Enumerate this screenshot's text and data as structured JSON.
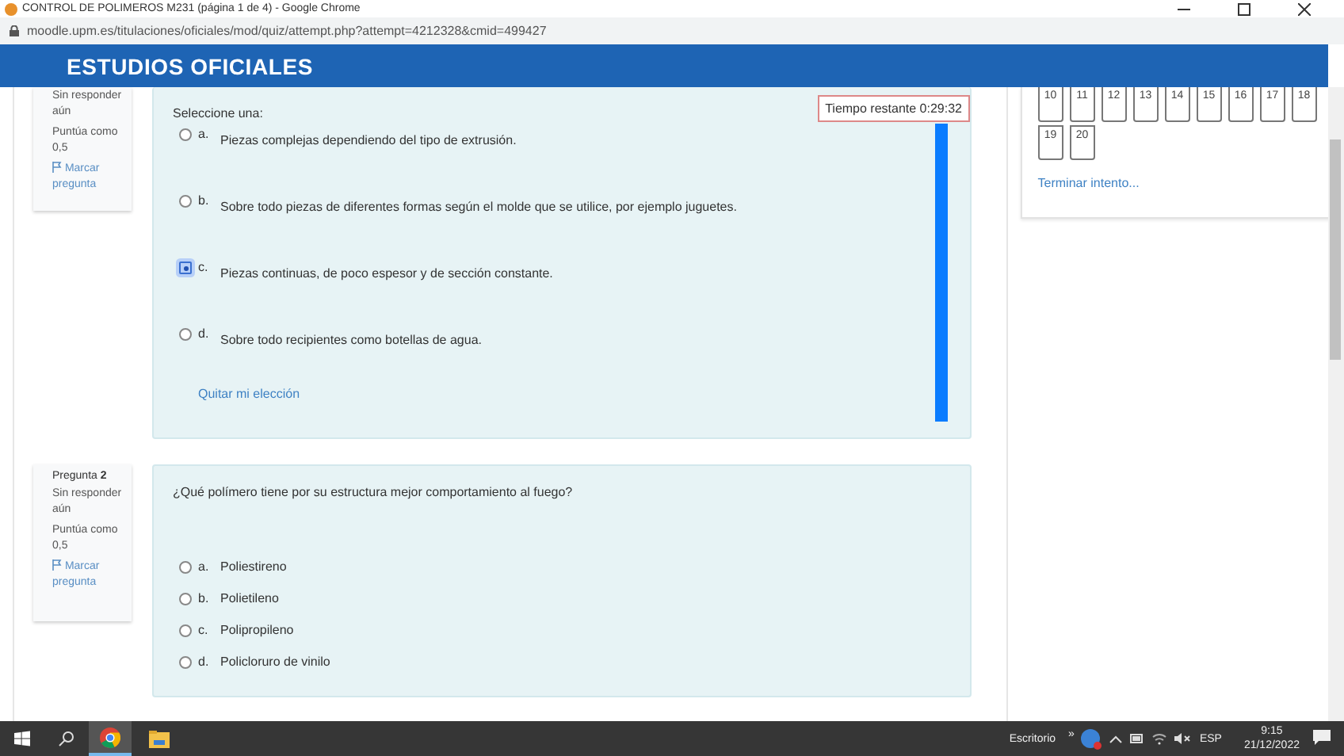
{
  "browser": {
    "title": "CONTROL DE POLIMEROS M231 (página 1 de 4) - Google Chrome",
    "url": "moodle.upm.es/titulaciones/oficiales/mod/quiz/attempt.php?attempt=4212328&cmid=499427"
  },
  "header": {
    "title": "ESTUDIOS OFICIALES"
  },
  "questions": [
    {
      "status": "Sin responder aún",
      "score": "Puntúa como 0,5",
      "flag": "Marcar pregunta",
      "prompt": "Seleccione una:",
      "timer": "Tiempo restante 0:29:32",
      "clear": "Quitar mi elección",
      "options": [
        {
          "letter": "a.",
          "text": "Piezas complejas dependiendo del tipo de extrusión.",
          "selected": false
        },
        {
          "letter": "b.",
          "text": "Sobre todo piezas de diferentes formas según el molde que se utilice, por ejemplo juguetes.",
          "selected": false
        },
        {
          "letter": "c.",
          "text": "Piezas continuas, de poco espesor y de sección constante.",
          "selected": true
        },
        {
          "letter": "d.",
          "text": "Sobre todo recipientes como botellas de agua.",
          "selected": false
        }
      ]
    },
    {
      "label": "Pregunta **2**",
      "status": "Sin responder aún",
      "score": "Puntúa como 0,5",
      "flag": "Marcar pregunta",
      "question": "¿Qué polímero tiene por su estructura mejor comportamiento al fuego?",
      "options": [
        {
          "letter": "a.",
          "text": "Poliestireno",
          "selected": false
        },
        {
          "letter": "b.",
          "text": "Polietileno",
          "selected": false
        },
        {
          "letter": "c.",
          "text": "Polipropileno",
          "selected": false
        },
        {
          "letter": "d.",
          "text": "Policloruro de vinilo",
          "selected": false
        }
      ]
    }
  ],
  "navigation": {
    "buttons": [
      "10",
      "11",
      "12",
      "13",
      "14",
      "15",
      "16",
      "17",
      "18",
      "19",
      "20"
    ],
    "finish": "Terminar intento..."
  },
  "taskbar": {
    "desktop": "Escritorio",
    "overflow": "»",
    "language": "ESP",
    "time": "9:15",
    "date": "21/12/2022"
  }
}
